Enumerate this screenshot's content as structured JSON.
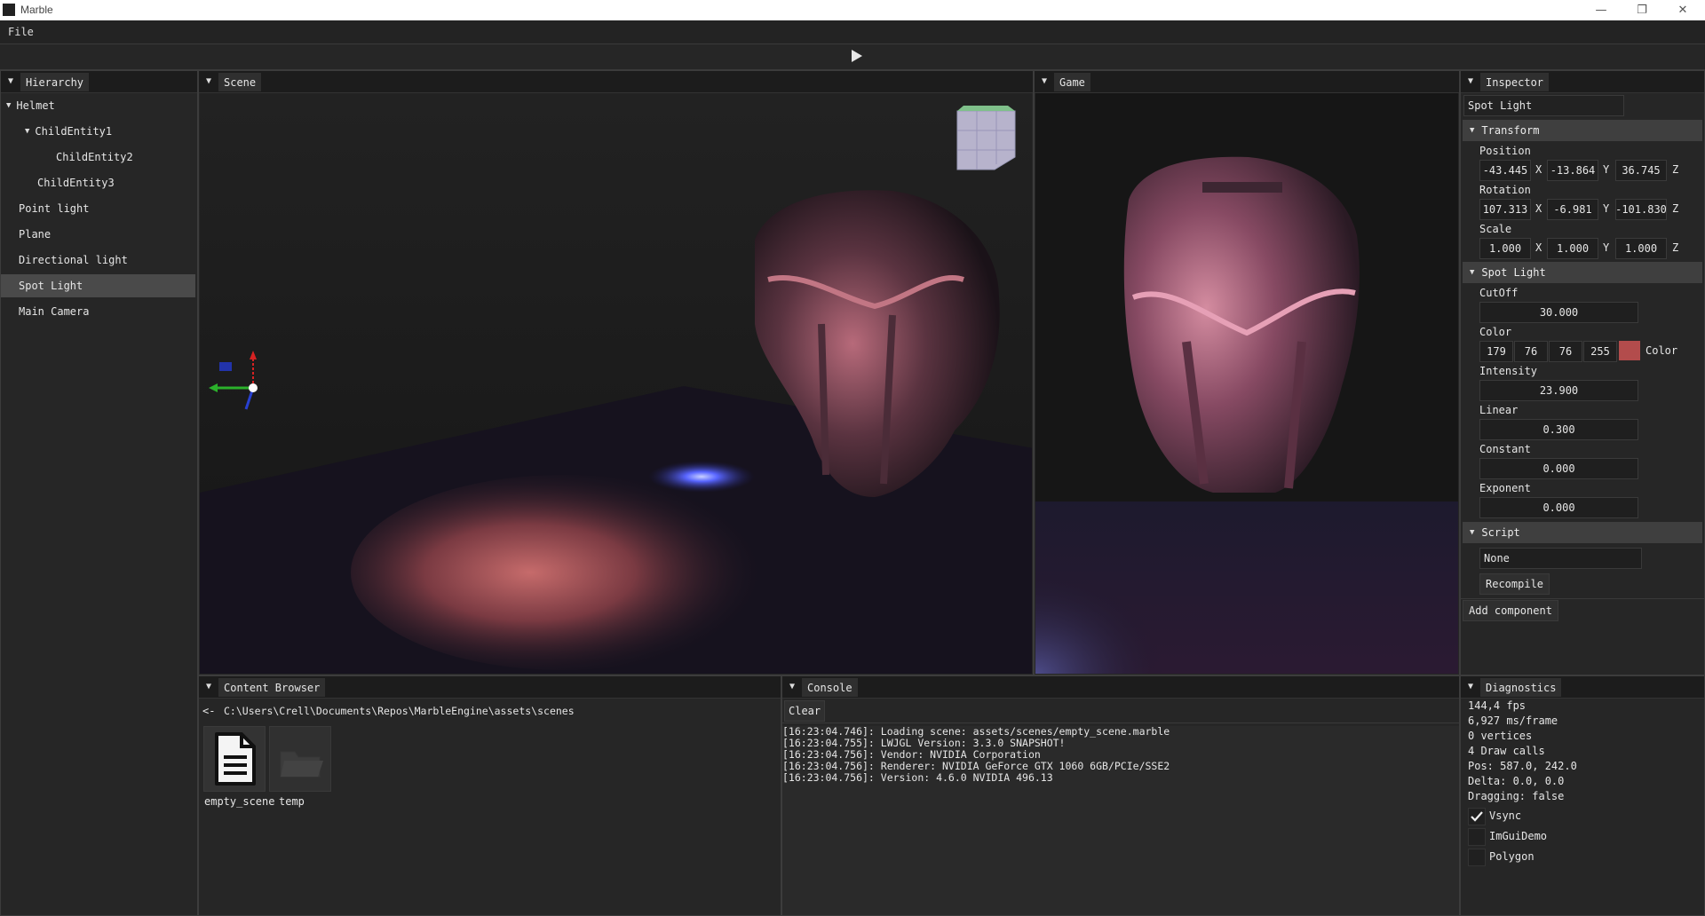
{
  "window": {
    "title": "Marble",
    "minimize": "—",
    "restore": "❐",
    "close": "✕"
  },
  "menubar": {
    "file": "File"
  },
  "toolbar": {
    "play_icon": "play-icon"
  },
  "hierarchy": {
    "tab": "Hierarchy",
    "items": [
      {
        "label": "Helmet",
        "expanded": true,
        "level": 0
      },
      {
        "label": "ChildEntity1",
        "expanded": true,
        "level": 1
      },
      {
        "label": "ChildEntity2",
        "level": 2
      },
      {
        "label": "ChildEntity3",
        "level": 1
      },
      {
        "label": "Point light",
        "level": 0
      },
      {
        "label": "Plane",
        "level": 0
      },
      {
        "label": "Directional light",
        "level": 0
      },
      {
        "label": "Spot Light",
        "level": 0,
        "selected": true
      },
      {
        "label": "Main Camera",
        "level": 0
      }
    ]
  },
  "scene": {
    "tab": "Scene"
  },
  "game": {
    "tab": "Game"
  },
  "inspector": {
    "tab": "Inspector",
    "entity_name": "Spot Light",
    "transform": {
      "header": "Transform",
      "position_label": "Position",
      "position": {
        "x": "-43.445",
        "y": "-13.864",
        "z": "36.745"
      },
      "rotation_label": "Rotation",
      "rotation": {
        "x": "107.313",
        "y": "-6.981",
        "z": "-101.830"
      },
      "scale_label": "Scale",
      "scale": {
        "x": "1.000",
        "y": "1.000",
        "z": "1.000"
      },
      "axis_x": "X",
      "axis_y": "Y",
      "axis_z": "Z"
    },
    "spot_light": {
      "header": "Spot Light",
      "cutoff_label": "CutOff",
      "cutoff": "30.000",
      "color_label": "Color",
      "r": "179",
      "g": "76",
      "b": "76",
      "a": "255",
      "color_swatch_label": "Color",
      "color_hex": "#b34c4c",
      "intensity_label": "Intensity",
      "intensity": "23.900",
      "linear_label": "Linear",
      "linear": "0.300",
      "constant_label": "Constant",
      "constant": "0.000",
      "exponent_label": "Exponent",
      "exponent": "0.000"
    },
    "script": {
      "header": "Script",
      "value": "None",
      "recompile": "Recompile"
    },
    "add_component": "Add component"
  },
  "content_browser": {
    "tab": "Content Browser",
    "back": "<-",
    "path": "C:\\Users\\Crell\\Documents\\Repos\\MarbleEngine\\assets\\scenes",
    "files": [
      {
        "name": "empty_scene",
        "icon": "document-icon"
      },
      {
        "name": "temp",
        "icon": "folder-icon"
      }
    ]
  },
  "console": {
    "tab": "Console",
    "clear": "Clear",
    "lines": [
      "[16:23:04.746]: Loading scene: assets/scenes/empty_scene.marble",
      "[16:23:04.755]: LWJGL Version: 3.3.0 SNAPSHOT!",
      "[16:23:04.756]: Vendor: NVIDIA Corporation",
      "[16:23:04.756]: Renderer: NVIDIA GeForce GTX 1060 6GB/PCIe/SSE2",
      "[16:23:04.756]: Version: 4.6.0 NVIDIA 496.13"
    ]
  },
  "diagnostics": {
    "tab": "Diagnostics",
    "lines": [
      "144,4 fps",
      "6,927 ms/frame",
      "0 vertices",
      "4 Draw calls",
      "Pos: 587.0, 242.0",
      "Delta: 0.0, 0.0",
      "Dragging: false"
    ],
    "vsync": "Vsync",
    "imgui_demo": "ImGuiDemo",
    "polygon": "Polygon"
  }
}
